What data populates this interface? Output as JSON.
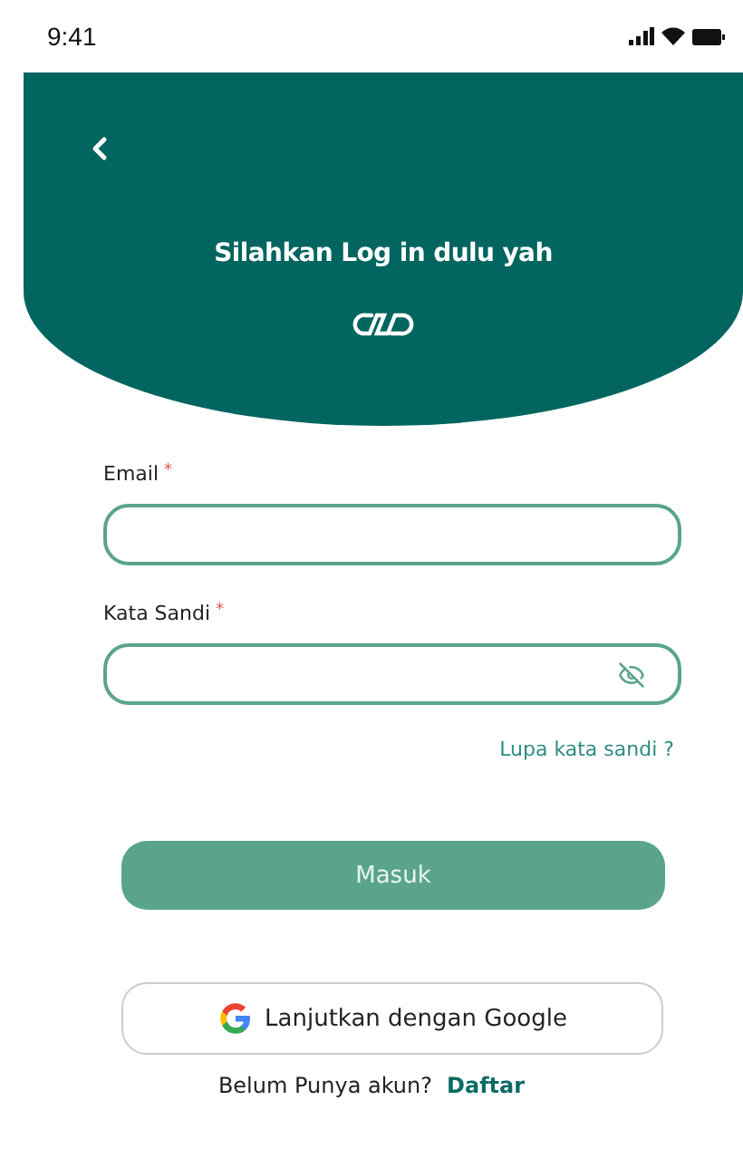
{
  "status_bar": {
    "time": "9:41"
  },
  "header": {
    "title": "Silahkan Log in dulu yah"
  },
  "fields": [
    {
      "label": "Email",
      "required_mark": "*",
      "kind": "text"
    },
    {
      "label": "Kata Sandi",
      "required_mark": "*",
      "kind": "password"
    }
  ],
  "forgot_link": "Lupa kata sandi ?",
  "login_button": "Masuk",
  "google_button": "Lanjutkan dengan Google",
  "signup": {
    "prompt": "Belum Punya akun?",
    "link": "Daftar"
  }
}
